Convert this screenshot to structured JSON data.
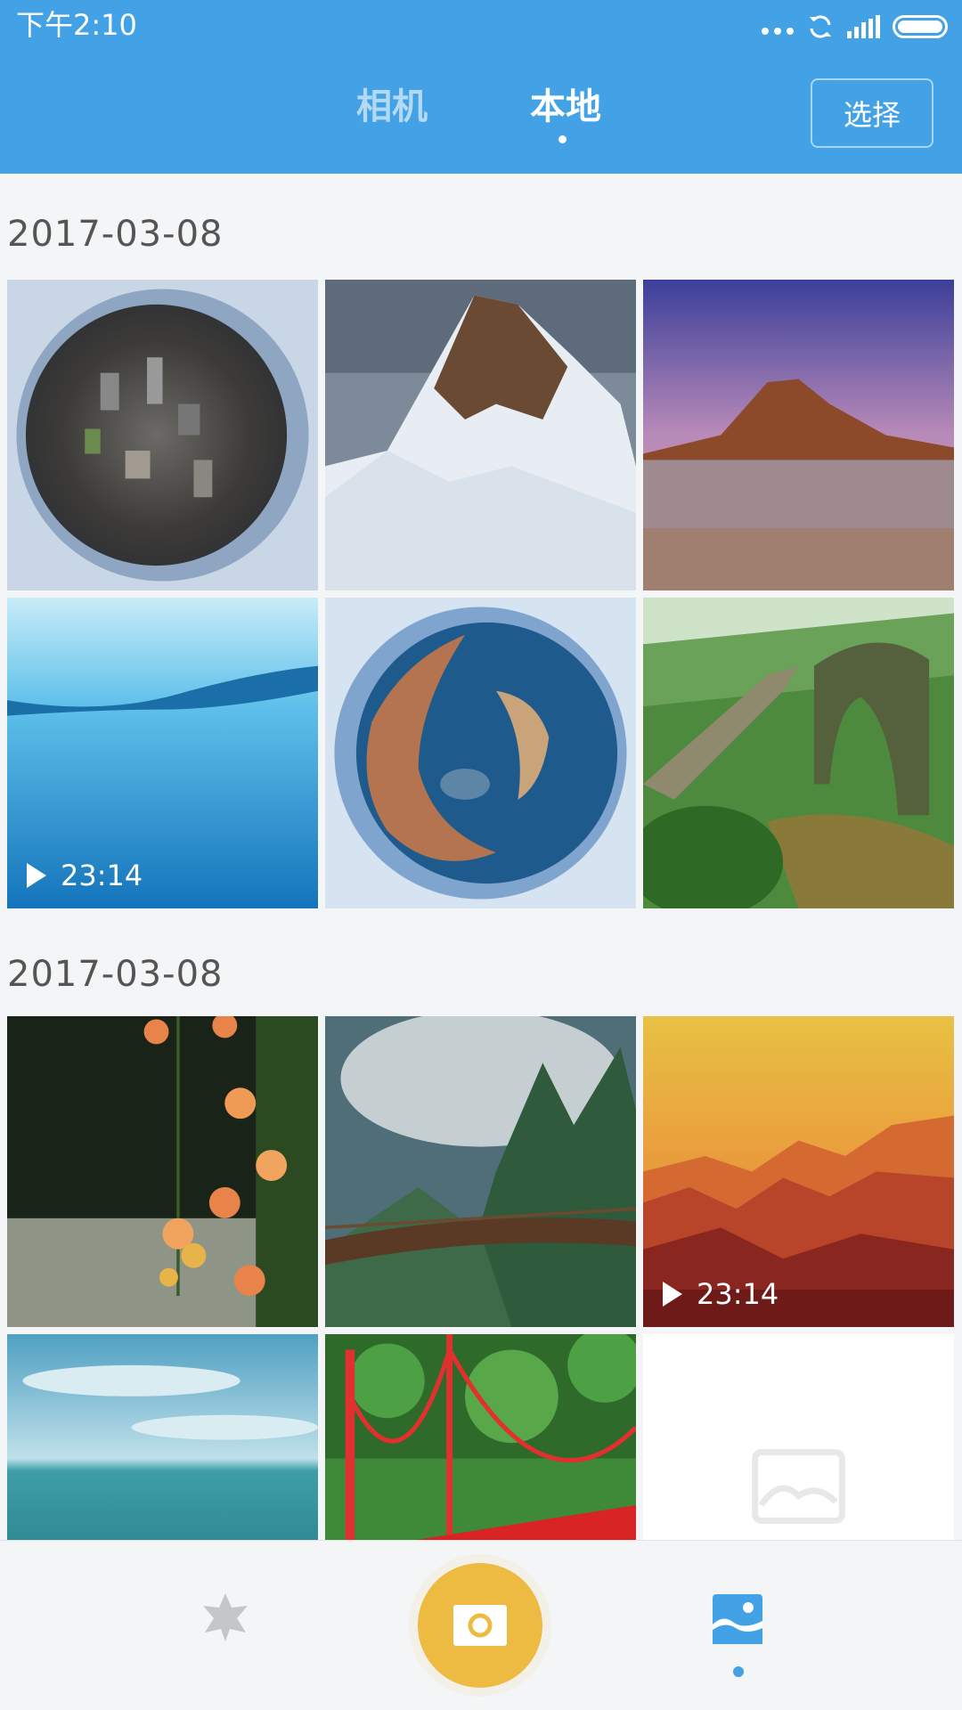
{
  "status_bar": {
    "time": "下午2:10"
  },
  "header": {
    "tabs": [
      {
        "label": "相机",
        "active": false
      },
      {
        "label": "本地",
        "active": true
      }
    ],
    "select_label": "选择"
  },
  "sections": [
    {
      "date": "2017-03-08",
      "items": [
        {
          "image": "planet-city"
        },
        {
          "image": "snowy-mountain-peak"
        },
        {
          "image": "rock-beach-dusk"
        },
        {
          "image": "ocean-water-surface",
          "duration": "23:14"
        },
        {
          "image": "planet-coast-harbor"
        },
        {
          "image": "mossy-stone-bridge"
        }
      ]
    },
    {
      "date": "2017-03-08",
      "items": [
        {
          "image": "orange-flowers"
        },
        {
          "image": "foggy-forest-bridge"
        },
        {
          "image": "orange-mountain-layers",
          "duration": "23:14"
        },
        {
          "image": "sea-horizon"
        },
        {
          "image": "red-suspension-bridge"
        },
        {
          "image": "image-placeholder"
        }
      ]
    }
  ],
  "bottom_nav": {
    "items": [
      "star-icon",
      "camera-shutter-icon",
      "gallery-icon"
    ],
    "active": "gallery-icon"
  },
  "colors": {
    "accent": "#43a1e6",
    "shutter": "#edba42",
    "background": "#f4f5f6"
  }
}
